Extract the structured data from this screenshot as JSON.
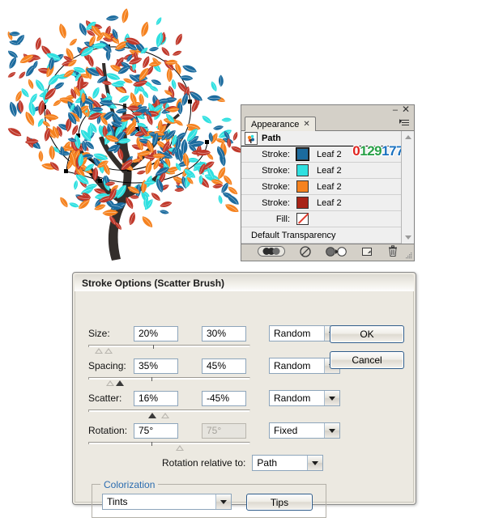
{
  "artwork": {
    "name": "illustrator-tree-artwork",
    "description": "Stylized tree with scatter-brush leaves and a selected spiral path",
    "trunk_color": "#332e2b",
    "leaf_colors": [
      "#f5821f",
      "#2fe0e0",
      "#c0392b",
      "#1b6b9e"
    ],
    "path_stroke": "#000000",
    "anchor_color": "#000000"
  },
  "appearance_panel": {
    "tab_label": "Appearance",
    "tab_close_glyph": "✕",
    "minimize_glyph": "–",
    "close_glyph": "✕",
    "menu_icon": "panel-menu-icon",
    "target_label": "Path",
    "rgb_readout": {
      "r": "0",
      "g": "129",
      "b": "177",
      "r_color": "#e0231e",
      "g_color": "#2aa148",
      "b_color": "#1b72c0"
    },
    "rows": [
      {
        "label": "Stroke:",
        "value": "Leaf 2",
        "swatch": "#1b6b9e",
        "selected": true
      },
      {
        "label": "Stroke:",
        "value": "Leaf 2",
        "swatch": "#2fe0e0",
        "selected": false
      },
      {
        "label": "Stroke:",
        "value": "Leaf 2",
        "swatch": "#f5821f",
        "selected": false
      },
      {
        "label": "Stroke:",
        "value": "Leaf 2",
        "swatch": "#a82317",
        "selected": false
      },
      {
        "label": "Fill:",
        "value": "",
        "swatch": "none",
        "selected": false
      }
    ],
    "transparency_row": "Default Transparency",
    "footer_icons": [
      "opacity-blend-icon",
      "clear-appearance-icon",
      "reduce-to-basic-appearance-icon",
      "duplicate-item-icon",
      "delete-item-icon"
    ],
    "scrollbar": {
      "up": "scroll-up-arrow",
      "down": "scroll-down-arrow"
    }
  },
  "dialog": {
    "title": "Stroke Options (Scatter Brush)",
    "fields": [
      {
        "name": "size",
        "label": "Size:",
        "min_value": "20%",
        "max_value": "30%",
        "max_disabled": false,
        "mode": "Random"
      },
      {
        "name": "spacing",
        "label": "Spacing:",
        "min_value": "35%",
        "max_value": "45%",
        "max_disabled": false,
        "mode": "Random"
      },
      {
        "name": "scatter",
        "label": "Scatter:",
        "min_value": "16%",
        "max_value": "-45%",
        "max_disabled": false,
        "mode": "Random"
      },
      {
        "name": "rotation",
        "label": "Rotation:",
        "min_value": "75°",
        "max_value": "75°",
        "max_disabled": true,
        "mode": "Fixed"
      }
    ],
    "rotation_relative_label": "Rotation relative to:",
    "rotation_relative_value": "Path",
    "colorization_legend": "Colorization",
    "colorization_value": "Tints",
    "tips_label": "Tips",
    "ok_label": "OK",
    "cancel_label": "Cancel"
  }
}
